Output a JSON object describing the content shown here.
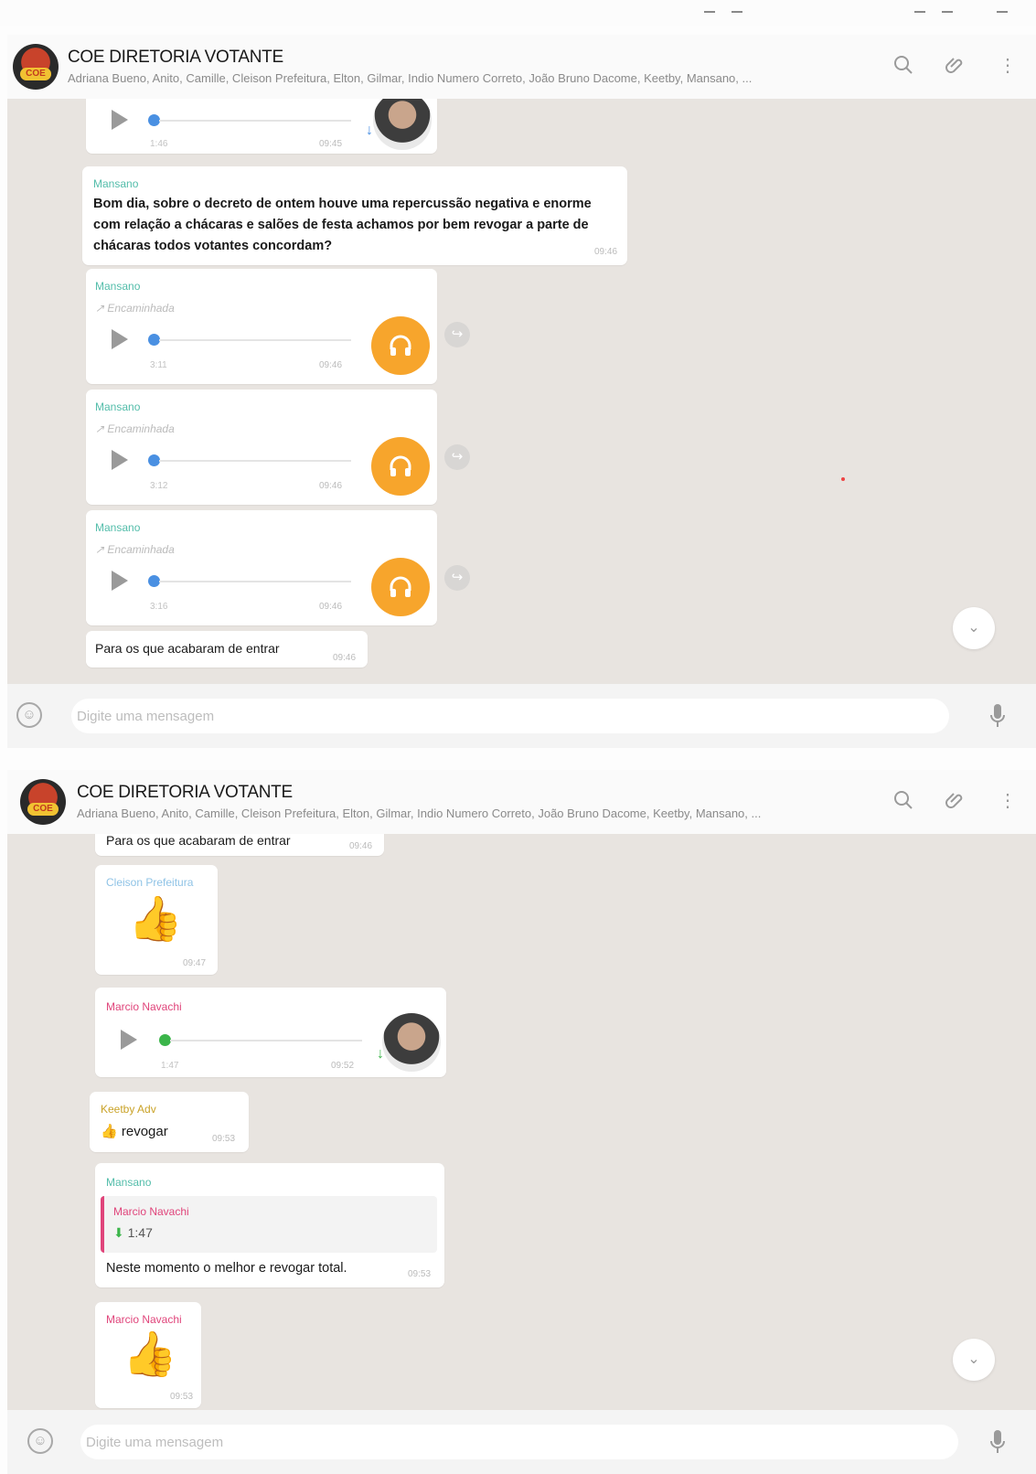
{
  "panel1": {
    "header": {
      "title": "COE DIRETORIA VOTANTE",
      "participants": "Adriana Bueno, Anito, Camille, Cleison Prefeitura, Elton, Gilmar, Indio Numero Correto, João Bruno Dacome, Keetby, Mansano, ..."
    },
    "messages": {
      "audio_top": {
        "duration": "1:46",
        "time": "09:45"
      },
      "text_mansano": {
        "sender": "Mansano",
        "text": "Bom dia, sobre o decreto de ontem houve uma repercussão negativa e enorme com relação a chácaras e salões de festa achamos por bem revogar a parte de chácaras todos votantes concordam?",
        "time": "09:46"
      },
      "fwd_audio_1": {
        "sender": "Mansano",
        "forwarded": "Encaminhada",
        "duration": "3:11",
        "time": "09:46"
      },
      "fwd_audio_2": {
        "sender": "Mansano",
        "forwarded": "Encaminhada",
        "duration": "3:12",
        "time": "09:46"
      },
      "fwd_audio_3": {
        "sender": "Mansano",
        "forwarded": "Encaminhada",
        "duration": "3:16",
        "time": "09:46"
      },
      "short_text": {
        "text": "Para os que acabaram de entrar",
        "time": "09:46"
      }
    },
    "compose": {
      "placeholder": "Digite uma mensagem"
    }
  },
  "panel2": {
    "header": {
      "title": "COE DIRETORIA VOTANTE",
      "participants": "Adriana Bueno, Anito, Camille, Cleison Prefeitura, Elton, Gilmar, Indio Numero Correto, João Bruno Dacome, Keetby, Mansano, ..."
    },
    "messages": {
      "short_text": {
        "text": "Para os que acabaram de entrar",
        "time": "09:46"
      },
      "thumb_cleison": {
        "sender": "Cleison Prefeitura",
        "emoji": "👍",
        "time": "09:47"
      },
      "audio_marcio": {
        "sender": "Marcio Navachi",
        "duration": "1:47",
        "time": "09:52"
      },
      "keetby": {
        "sender": "Keetby Adv",
        "emoji": "👍",
        "text": "revogar",
        "time": "09:53"
      },
      "reply_mansano": {
        "sender": "Mansano",
        "quoted_sender": "Marcio Navachi",
        "quoted_duration": "1:47",
        "text": "Neste momento o melhor e revogar total.",
        "time": "09:53"
      },
      "thumb_marcio": {
        "sender": "Marcio Navachi",
        "emoji": "👍",
        "time": "09:53"
      }
    },
    "compose": {
      "placeholder": "Digite uma mensagem"
    }
  },
  "colors": {
    "chat_bg": "#e8e4e0",
    "mansano": "#53bdaa",
    "marcio": "#e0457b",
    "keetby": "#c9a227",
    "cleison": "#8fc3e6",
    "headphones": "#f7a52c",
    "seen_dot_blue": "#4a90e2",
    "seen_dot_green": "#3bb54a"
  },
  "icons": [
    "search-icon",
    "attach-icon",
    "menu-icon",
    "emoji-icon",
    "mic-icon",
    "play-icon",
    "headphones-icon",
    "forward-icon",
    "chevron-down-icon"
  ]
}
